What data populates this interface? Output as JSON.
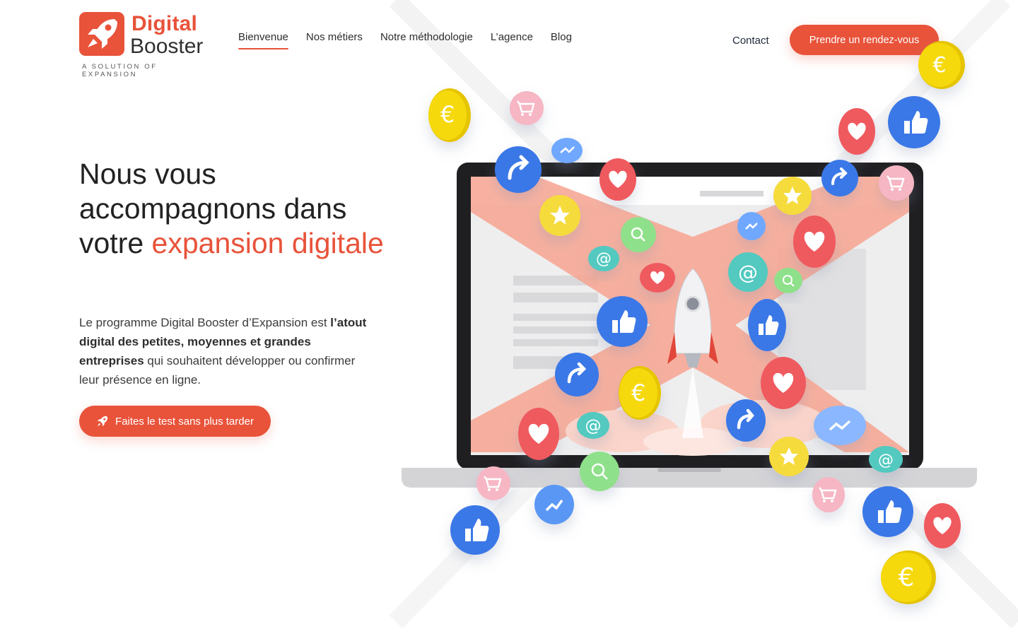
{
  "brand": {
    "name_line1": "Digital",
    "name_line2": "Booster",
    "tagline": "A SOLUTION OF EXPANSION",
    "accent_color": "#e8533a"
  },
  "nav": {
    "items": [
      {
        "label": "Bienvenue",
        "active": true
      },
      {
        "label": "Nos métiers"
      },
      {
        "label": "Notre méthodologie"
      },
      {
        "label": "L’agence"
      },
      {
        "label": "Blog"
      }
    ],
    "contact": "Contact",
    "cta": "Prendre un rendez-vous"
  },
  "hero": {
    "title_part1": "Nous vous accompagnons dans votre ",
    "title_accent": "expansion digitale",
    "text_part1": "Le programme Digital Booster d’Expansion est ",
    "text_bold": "l’atout digital des petites, moyennes et grandes entreprises",
    "text_part2": " qui souhaitent développer ou confirmer leur présence en ligne.",
    "cta": "Faites le test sans plus tarder"
  },
  "illustration": {
    "icons": [
      "euro-coin-icon",
      "cart-icon",
      "share-icon",
      "heart-icon",
      "like-icon",
      "star-icon",
      "at-sign-icon",
      "trend-icon",
      "search-icon"
    ],
    "colors": {
      "blue": "#3b78e7",
      "red": "#ef5a5f",
      "yellow": "#f5d90a",
      "green": "#8fe08a",
      "teal": "#52c9c0",
      "pink": "#f6b6c4",
      "salmon": "#f7a38f"
    }
  }
}
